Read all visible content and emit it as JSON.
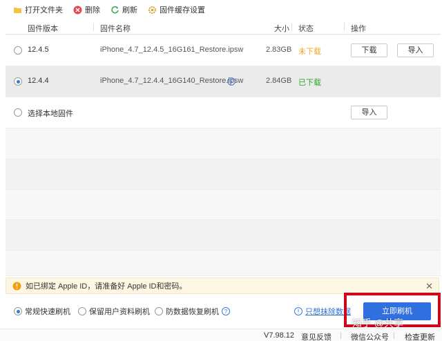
{
  "toolbar": {
    "open_folder": "打开文件夹",
    "delete": "删除",
    "refresh": "刷新",
    "cache_settings": "固件缓存设置"
  },
  "table": {
    "headers": [
      "固件版本",
      "固件名称",
      "大小",
      "状态",
      "操作"
    ],
    "rows": [
      {
        "version": "12.4.5",
        "name": "iPhone_4.7_12.4.5_16G161_Restore.ipsw",
        "size": "2.83GB",
        "status": "未下载",
        "status_color": "#f5a623",
        "download": "下载",
        "import": "导入",
        "selected": false
      },
      {
        "version": "12.4.4",
        "name": "iPhone_4.7_12.4.4_16G140_Restore.ipsw",
        "size": "2.84GB",
        "status": "已下载",
        "status_color": "#2aa52a",
        "selected": true
      },
      {
        "version": "选择本地固件",
        "import": "导入",
        "selected": false
      }
    ]
  },
  "notice": {
    "text": "如已绑定 Apple ID，请准备好 Apple ID和密码。"
  },
  "modes": {
    "normal": "常规快速刷机",
    "keep_data": "保留用户资料刷机",
    "anti_recovery": "防数据恢复刷机",
    "jailbreak_link": "只想抹除数据",
    "selected": "normal"
  },
  "flash_button": "立即刷机",
  "watermark": "知乎 @共享",
  "status_bar": {
    "version": "V7.98.12",
    "feedback": "意见反馈",
    "wechat": "微信公众号",
    "check_update": "检查更新"
  },
  "colors": {
    "accent": "#3170e0",
    "highlight_border": "#d0021b",
    "not_downloaded": "#f5a623",
    "downloaded": "#2aa52a"
  }
}
